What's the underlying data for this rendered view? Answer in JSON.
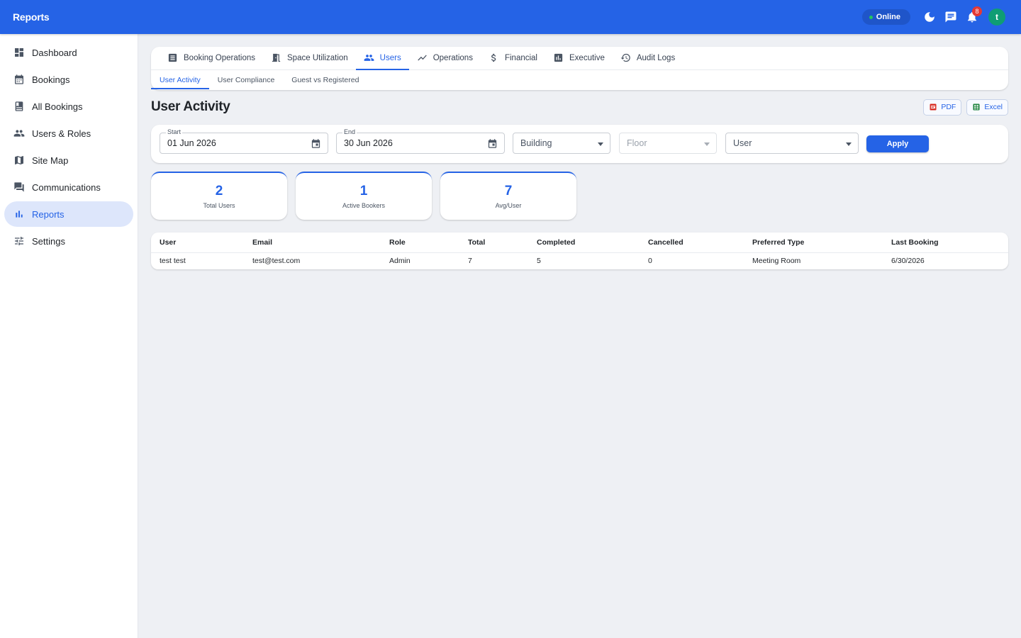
{
  "app": {
    "title": "Reports"
  },
  "topbar": {
    "status": "Online",
    "notification_count": "8",
    "avatar_initial": "t"
  },
  "sidebar": {
    "items": [
      {
        "label": "Dashboard"
      },
      {
        "label": "Bookings"
      },
      {
        "label": "All Bookings"
      },
      {
        "label": "Users & Roles"
      },
      {
        "label": "Site Map"
      },
      {
        "label": "Communications"
      },
      {
        "label": "Reports"
      },
      {
        "label": "Settings"
      }
    ]
  },
  "tabs": [
    {
      "label": "Booking Operations"
    },
    {
      "label": "Space Utilization"
    },
    {
      "label": "Users"
    },
    {
      "label": "Operations"
    },
    {
      "label": "Financial"
    },
    {
      "label": "Executive"
    },
    {
      "label": "Audit Logs"
    }
  ],
  "subtabs": [
    {
      "label": "User Activity"
    },
    {
      "label": "User Compliance"
    },
    {
      "label": "Guest vs Registered"
    }
  ],
  "page": {
    "title": "User Activity"
  },
  "export": {
    "pdf": "PDF",
    "excel": "Excel"
  },
  "filters": {
    "start_label": "Start",
    "start_value": "01 Jun 2026",
    "end_label": "End",
    "end_value": "30 Jun 2026",
    "building": "Building",
    "floor": "Floor",
    "user": "User",
    "apply": "Apply"
  },
  "stats": [
    {
      "value": "2",
      "label": "Total Users"
    },
    {
      "value": "1",
      "label": "Active Bookers"
    },
    {
      "value": "7",
      "label": "Avg/User"
    }
  ],
  "table": {
    "headers": [
      "User",
      "Email",
      "Role",
      "Total",
      "Completed",
      "Cancelled",
      "Preferred Type",
      "Last Booking"
    ],
    "rows": [
      [
        "test test",
        "test@test.com",
        "Admin",
        "7",
        "5",
        "0",
        "Meeting Room",
        "6/30/2026"
      ]
    ]
  },
  "colors": {
    "primary": "#2563e6",
    "topbar": "#2563e6",
    "online": "#22c55e",
    "badge": "#e53935",
    "avatar": "#0f9d74"
  }
}
